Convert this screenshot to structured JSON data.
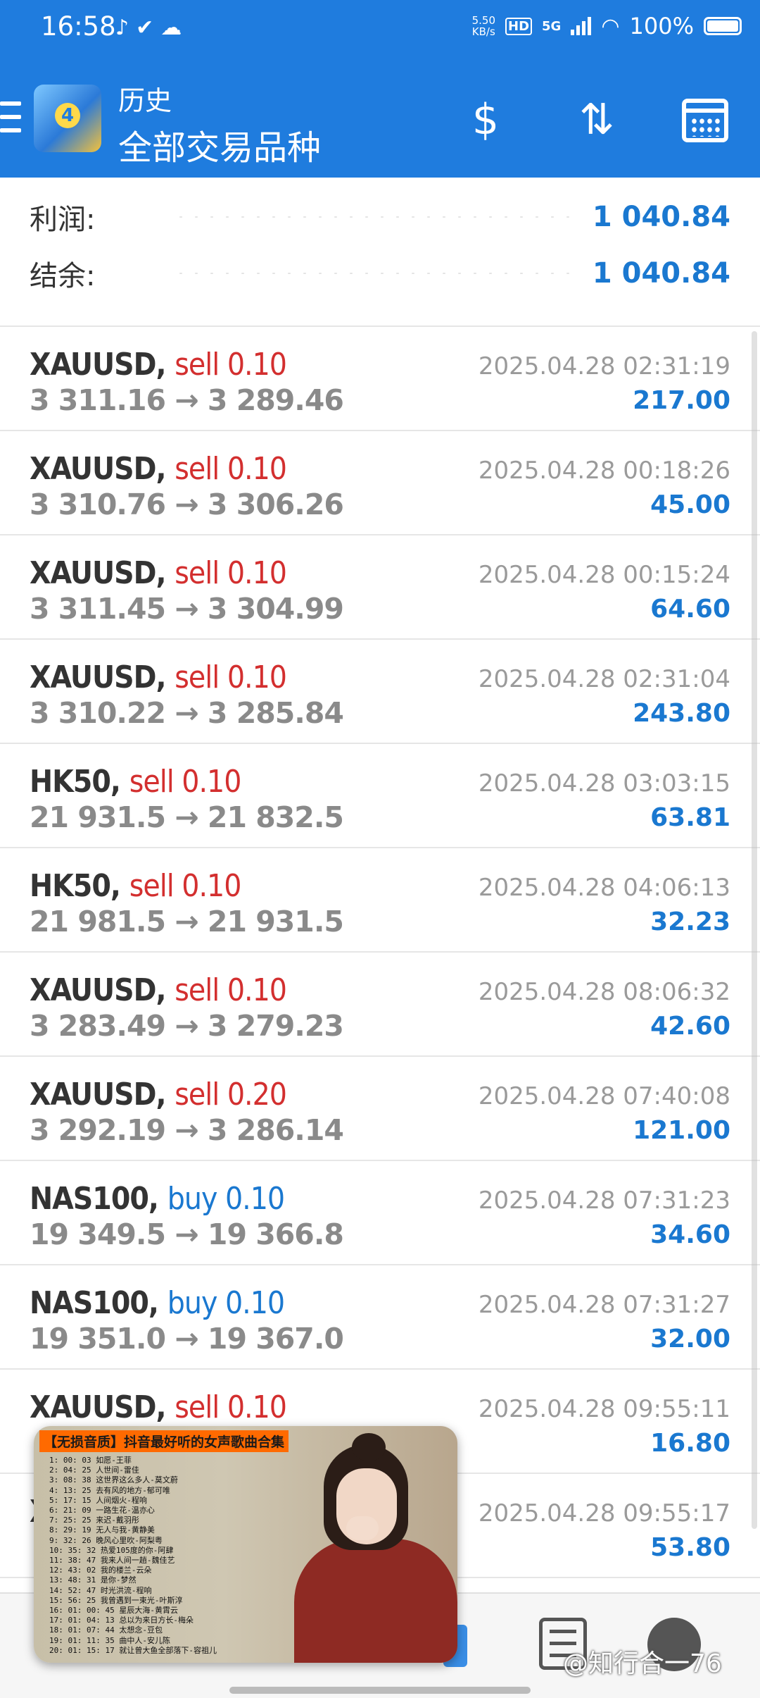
{
  "status_bar": {
    "time": "16:58",
    "net_speed_value": "5.50",
    "net_speed_unit": "KB/s",
    "hd": "HD",
    "signal": "5G",
    "battery": "100%"
  },
  "header": {
    "subtitle": "历史",
    "title": "全部交易品种",
    "logo_text": "4",
    "icons": [
      "menu-icon",
      "dollar-exchange-icon",
      "sort-icon",
      "calendar-icon"
    ]
  },
  "summary": {
    "profit_label": "利润:",
    "profit_value": "1 040.84",
    "balance_label": "结余:",
    "balance_value": "1 040.84"
  },
  "trades": [
    {
      "symbol": "XAUUSD,",
      "side": "sell 0.10",
      "side_type": "sell",
      "prices": "3 311.16 → 3 289.46",
      "datetime": "2025.04.28 02:31:19",
      "profit": "217.00"
    },
    {
      "symbol": "XAUUSD,",
      "side": "sell 0.10",
      "side_type": "sell",
      "prices": "3 310.76 → 3 306.26",
      "datetime": "2025.04.28 00:18:26",
      "profit": "45.00"
    },
    {
      "symbol": "XAUUSD,",
      "side": "sell 0.10",
      "side_type": "sell",
      "prices": "3 311.45 → 3 304.99",
      "datetime": "2025.04.28 00:15:24",
      "profit": "64.60"
    },
    {
      "symbol": "XAUUSD,",
      "side": "sell 0.10",
      "side_type": "sell",
      "prices": "3 310.22 → 3 285.84",
      "datetime": "2025.04.28 02:31:04",
      "profit": "243.80"
    },
    {
      "symbol": "HK50,",
      "side": "sell 0.10",
      "side_type": "sell",
      "prices": "21 931.5 → 21 832.5",
      "datetime": "2025.04.28 03:03:15",
      "profit": "63.81"
    },
    {
      "symbol": "HK50,",
      "side": "sell 0.10",
      "side_type": "sell",
      "prices": "21 981.5 → 21 931.5",
      "datetime": "2025.04.28 04:06:13",
      "profit": "32.23"
    },
    {
      "symbol": "XAUUSD,",
      "side": "sell 0.10",
      "side_type": "sell",
      "prices": "3 283.49 → 3 279.23",
      "datetime": "2025.04.28 08:06:32",
      "profit": "42.60"
    },
    {
      "symbol": "XAUUSD,",
      "side": "sell 0.20",
      "side_type": "sell",
      "prices": "3 292.19 → 3 286.14",
      "datetime": "2025.04.28 07:40:08",
      "profit": "121.00"
    },
    {
      "symbol": "NAS100,",
      "side": "buy 0.10",
      "side_type": "buy",
      "prices": "19 349.5 → 19 366.8",
      "datetime": "2025.04.28 07:31:23",
      "profit": "34.60"
    },
    {
      "symbol": "NAS100,",
      "side": "buy 0.10",
      "side_type": "buy",
      "prices": "19 351.0 → 19 367.0",
      "datetime": "2025.04.28 07:31:27",
      "profit": "32.00"
    },
    {
      "symbol": "XAUUSD,",
      "side": "sell 0.10",
      "side_type": "sell",
      "prices": "",
      "datetime": "2025.04.28 09:55:11",
      "profit": "16.80"
    },
    {
      "symbol": "X",
      "side": "",
      "side_type": "sell",
      "prices": "",
      "datetime": "2025.04.28 09:55:17",
      "profit": "53.80"
    }
  ],
  "overlay": {
    "banner": "【无损音质】抖音最好听的女声歌曲合集",
    "tracks": [
      "1: 00: 03 如愿-王菲",
      "2: 04: 25 人世间-雷佳",
      "3: 08: 38 这世界这么多人-莫文蔚",
      "4: 13: 25 去有风的地方-郁可唯",
      "5: 17: 15 人间烟火-程响",
      "6: 21: 09 一路生花-温亦心",
      "7: 25: 25 来迟-戴羽彤",
      "8: 29: 19 无人与我-黄静美",
      "9: 32: 26 晚风心里吹-阿梨粤",
      "10: 35: 32 热爱105度的你-阿肆",
      "11: 38: 47 我来人间一趟-魏佳艺",
      "12: 43: 02 我的楼兰-云朵",
      "13: 48: 31 是你-梦然",
      "14: 52: 47 时光洪流-程响",
      "15: 56: 25 我曾遇到一束光-叶斯淳",
      "16: 01: 00: 45 星辰大海-黄霄云",
      "17: 01: 04: 13 总以为来日方长-梅朵",
      "18: 01: 07: 44 太想念-豆包",
      "19: 01: 11: 35 曲中人-安儿陈",
      "20: 01: 15: 17 就让曾大鱼全部落下-容祖儿"
    ]
  },
  "watermark": "@知行合一76"
}
